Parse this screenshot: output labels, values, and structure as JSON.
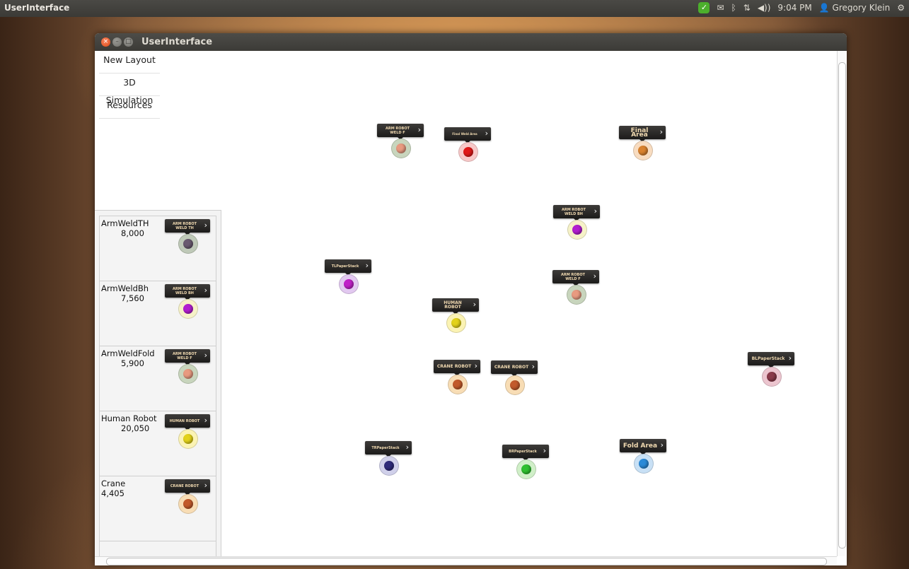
{
  "topbar": {
    "app_title": "UserInterface",
    "time": "9:04 PM",
    "user": "Gregory Klein",
    "icons": [
      "check-shield-icon",
      "mail-icon",
      "bluetooth-icon",
      "network-icon",
      "volume-icon",
      "user-icon",
      "gear-icon"
    ]
  },
  "window": {
    "title": "UserInterface",
    "menu": [
      "New Layout",
      "3D Simulation",
      "Resources"
    ]
  },
  "palette": [
    {
      "name": "ArmWeldTH",
      "value": "8,000",
      "tag": "ARM ROBOT WELD TH",
      "color": "#6a5a70",
      "halo": "#bfc9b8"
    },
    {
      "name": "ArmWeldBh",
      "value": "7,560",
      "tag": "ARM ROBOT WELD BH",
      "color": "#b21fd0",
      "halo": "#f6f2c8"
    },
    {
      "name": "ArmWeldFold",
      "value": "5,900",
      "tag": "ARM ROBOT WELD F",
      "color": "#e89a80",
      "halo": "#c8d5bd"
    },
    {
      "name": "Human Robot",
      "value": "20,050",
      "tag": "HUMAN ROBOT",
      "color": "#e2d21a",
      "halo": "#fbf3b4"
    },
    {
      "name": "Crane",
      "value": "4,405",
      "tag": "CRANE ROBOT",
      "color": "#c25a2c",
      "halo": "#f8ddb5"
    }
  ],
  "canvas_nodes": [
    {
      "label": "ARM ROBOT WELD F",
      "color": "#e89a80",
      "halo": "#c8d5bd"
    },
    {
      "label": "Final Weld Area",
      "color": "#e01818",
      "halo": "#f8c8c8"
    },
    {
      "label": "Final Area",
      "color": "#d9822e",
      "halo": "#f8dcc0"
    },
    {
      "label": "ARM ROBOT WELD BH",
      "color": "#b21fd0",
      "halo": "#f6f2c8"
    },
    {
      "label": "TLPaperStack",
      "color": "#c020c8",
      "halo": "#e2c8f0"
    },
    {
      "label": "ARM ROBOT WELD F",
      "color": "#e89a80",
      "halo": "#c8d5bd"
    },
    {
      "label": "HUMAN ROBOT",
      "color": "#e2d21a",
      "halo": "#fbf3b4"
    },
    {
      "label": "CRANE ROBOT",
      "color": "#c25a2c",
      "halo": "#f8ddb5"
    },
    {
      "label": "CRANE ROBOT",
      "color": "#c25a2c",
      "halo": "#f8ddb5"
    },
    {
      "label": "BLPaperStack",
      "color": "#8a3a4a",
      "halo": "#ecc5cf"
    },
    {
      "label": "TRPaperStack",
      "color": "#2e2a7a",
      "halo": "#d0d0ea"
    },
    {
      "label": "BRPaperStack",
      "color": "#2fc030",
      "halo": "#d0efc8"
    },
    {
      "label": "Fold Area",
      "color": "#2a8ad8",
      "halo": "#c8e0f5"
    }
  ]
}
